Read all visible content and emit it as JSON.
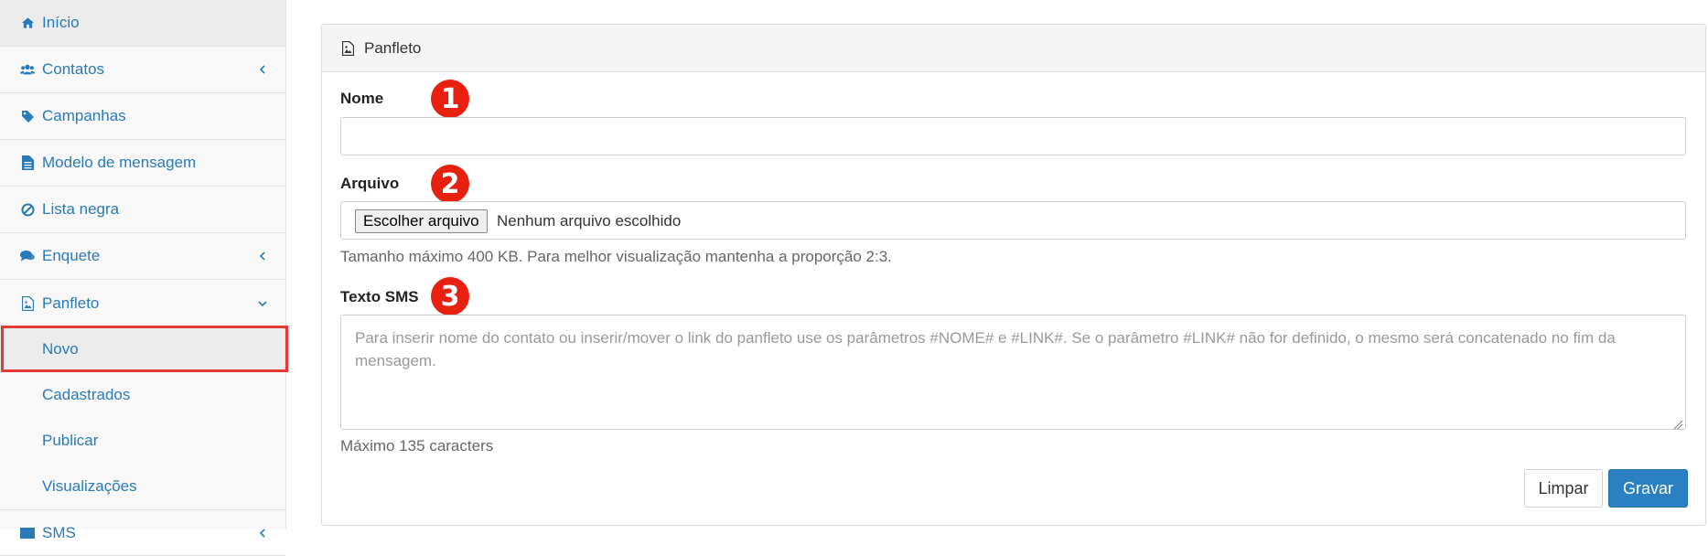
{
  "sidebar": {
    "items": [
      {
        "label": "Início",
        "icon": "home-icon",
        "has_chevron": false
      },
      {
        "label": "Contatos",
        "icon": "users-icon",
        "has_chevron": true
      },
      {
        "label": "Campanhas",
        "icon": "tag-icon",
        "has_chevron": false
      },
      {
        "label": "Modelo de mensagem",
        "icon": "file-text-icon",
        "has_chevron": false
      },
      {
        "label": "Lista negra",
        "icon": "ban-icon",
        "has_chevron": false
      },
      {
        "label": "Enquete",
        "icon": "comments-icon",
        "has_chevron": true
      },
      {
        "label": "Panfleto",
        "icon": "image-file-icon",
        "has_chevron": true,
        "expanded": true
      }
    ],
    "subitems": [
      {
        "label": "Novo",
        "selected": true
      },
      {
        "label": "Cadastrados"
      },
      {
        "label": "Publicar"
      },
      {
        "label": "Visualizações"
      }
    ],
    "next_item": {
      "label": "SMS",
      "icon": "envelope-icon"
    }
  },
  "panel": {
    "title": "Panfleto",
    "icon": "image-file-icon"
  },
  "form": {
    "name_label": "Nome",
    "name_value": "",
    "file_label": "Arquivo",
    "file_button": "Escolher arquivo",
    "file_status": "Nenhum arquivo escolhido",
    "file_help": "Tamanho máximo 400 KB. Para melhor visualização mantenha a proporção 2:3.",
    "sms_label": "Texto SMS",
    "sms_placeholder": "Para inserir nome do contato ou inserir/mover o link do panfleto use os parâmetros #NOME# e #LINK#. Se o parâmetro #LINK# não for definido, o mesmo será concatenado no fim da mensagem.",
    "sms_help": "Máximo 135 caracters",
    "clear_button": "Limpar",
    "save_button": "Gravar"
  },
  "annotations": {
    "badge_1": "1",
    "badge_2": "2",
    "badge_3": "3"
  },
  "colors": {
    "link": "#2a7ab8",
    "primary_button": "#2a80c0",
    "badge": "#e8200f",
    "highlight_border": "#e53935"
  }
}
